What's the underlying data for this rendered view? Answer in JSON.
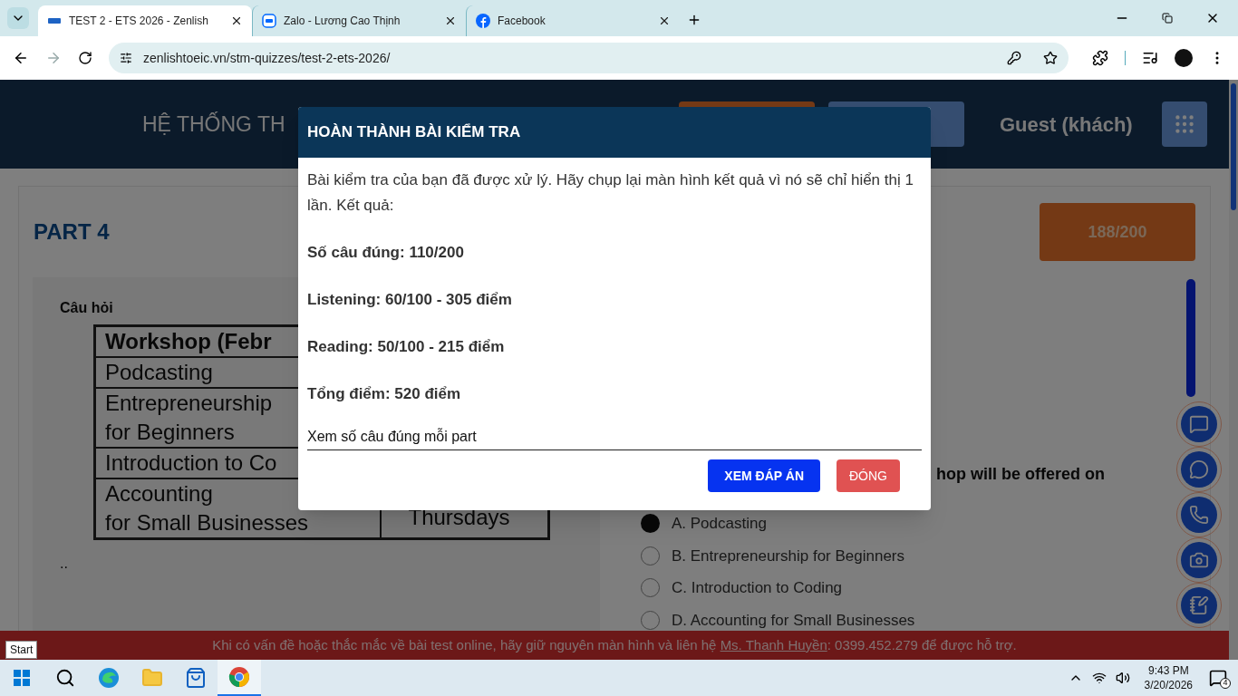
{
  "browser": {
    "tabs": [
      {
        "title": "TEST 2 - ETS 2026 - Zenlish",
        "selected": true
      },
      {
        "title": "Zalo - Lương Cao Thịnh",
        "selected": false
      },
      {
        "title": "Facebook",
        "selected": false
      }
    ],
    "url": "zenlishtoeic.vn/stm-quizzes/test-2-ets-2026/"
  },
  "header": {
    "title": "HỆ THỐNG TH",
    "user": "Guest (khách)"
  },
  "part": {
    "title": "PART 4",
    "score": "188/200"
  },
  "question": {
    "label": "Câu hỏi",
    "table": [
      {
        "kind": "header",
        "name": "Workshop (Febr"
      },
      {
        "kind": "row",
        "name": "Podcasting"
      },
      {
        "kind": "row",
        "name": "Entrepreneurship\nfor Beginners"
      },
      {
        "kind": "row",
        "name": "Introduction to Co"
      },
      {
        "kind": "row",
        "name": "Accounting\nfor Small Businesses",
        "day": "Thursdays"
      }
    ],
    "note": "..",
    "text": "hop will be offered on",
    "progress": {
      "level": 1
    },
    "options": [
      {
        "label": "A. Podcasting",
        "selected": true
      },
      {
        "label": "B. Entrepreneurship for Beginners",
        "selected": false
      },
      {
        "label": "C. Introduction to Coding",
        "selected": false
      },
      {
        "label": "D. Accounting for Small Businesses",
        "selected": false
      }
    ]
  },
  "modal": {
    "title": "HOÀN THÀNH BÀI KIỂM TRA",
    "message": "Bài kiểm tra của bạn đã được xử lý. Hãy chụp lại màn hình kết quả vì nó sẽ chỉ hiển thị 1 lần. Kết quả:",
    "results": [
      "Số câu đúng: 110/200",
      "Listening: 60/100 - 305 điểm",
      "Reading: 50/100 - 215 điểm",
      "Tổng điểm: 520 điểm"
    ],
    "details": "Xem số câu đúng mỗi part",
    "buttons": [
      {
        "label": "XEM ĐÁP ÁN",
        "kind": "primary"
      },
      {
        "label": "ĐÓNG",
        "kind": "danger"
      }
    ]
  },
  "support_bar": {
    "before": "Khi có vấn đề hoặc thắc mắc về bài test online, hãy giữ nguyên màn hình và liên hệ",
    "contact": "Ms. Thanh Huyền",
    "after": ": 0399.452.279 để được hỗ trợ."
  },
  "tooltip": "Start",
  "taskbar": {
    "time": "9:43 PM",
    "date": "3/20/2026",
    "notifications": "4"
  }
}
